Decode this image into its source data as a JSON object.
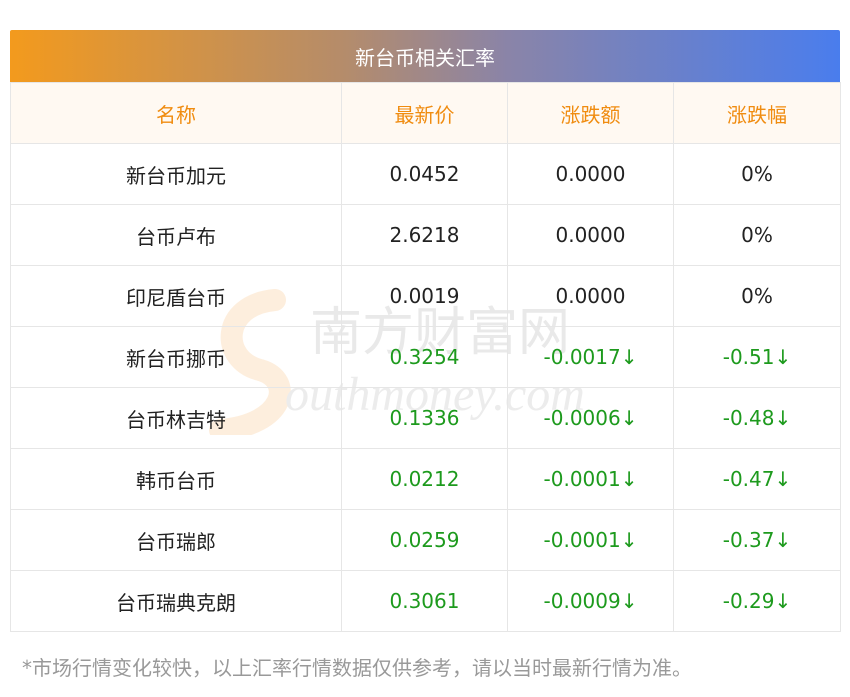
{
  "title": "新台币相关汇率",
  "columns": [
    "名称",
    "最新价",
    "涨跌额",
    "涨跌幅"
  ],
  "rows": [
    {
      "name": "新台币加元",
      "price": "0.0452",
      "change": "0.0000",
      "pct": "0%",
      "trend": "flat"
    },
    {
      "name": "台币卢布",
      "price": "2.6218",
      "change": "0.0000",
      "pct": "0%",
      "trend": "flat"
    },
    {
      "name": "印尼盾台币",
      "price": "0.0019",
      "change": "0.0000",
      "pct": "0%",
      "trend": "flat"
    },
    {
      "name": "新台币挪币",
      "price": "0.3254",
      "change": "-0.0017↓",
      "pct": "-0.51↓",
      "trend": "down"
    },
    {
      "name": "台币林吉特",
      "price": "0.1336",
      "change": "-0.0006↓",
      "pct": "-0.48↓",
      "trend": "down"
    },
    {
      "name": "韩币台币",
      "price": "0.0212",
      "change": "-0.0001↓",
      "pct": "-0.47↓",
      "trend": "down"
    },
    {
      "name": "台币瑞郎",
      "price": "0.0259",
      "change": "-0.0001↓",
      "pct": "-0.37↓",
      "trend": "down"
    },
    {
      "name": "台币瑞典克朗",
      "price": "0.3061",
      "change": "-0.0009↓",
      "pct": "-0.29↓",
      "trend": "down"
    }
  ],
  "footer": "*市场行情变化较快，以上汇率行情数据仅供参考，请以当时最新行情为准。",
  "watermark": {
    "cn": "南方财富网",
    "en": "outhmoney.com"
  },
  "colors": {
    "header_text": "#f08c10",
    "down": "#1d9a1d",
    "footer": "#999999"
  }
}
